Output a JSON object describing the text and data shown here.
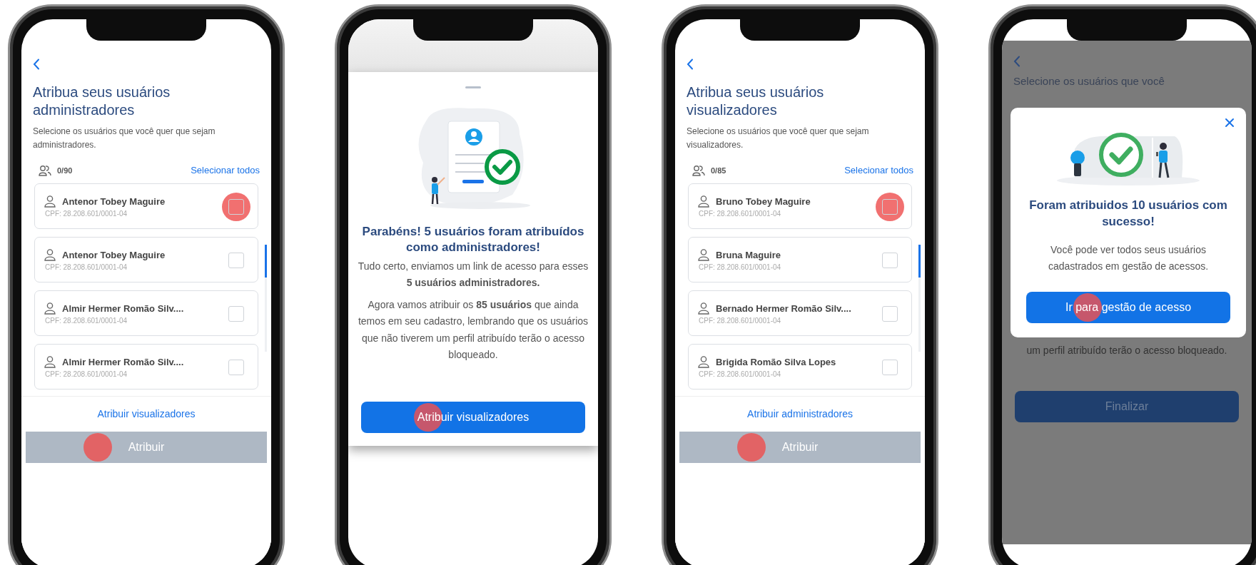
{
  "phones": [
    {
      "kind": "list",
      "title": "Atribua seus usuários administradores",
      "subtitle": "Selecione os usuários que você quer que sejam administradores.",
      "count": "0/90",
      "select_all": "Selecionar todos",
      "users": [
        {
          "name": "Antenor Tobey Maguire",
          "cpf": "CPF: 28.208.601/0001-04",
          "checked": false,
          "tapped": true
        },
        {
          "name": "Antenor Tobey Maguire",
          "cpf": "CPF: 28.208.601/0001-04",
          "checked": false,
          "tapped": false
        },
        {
          "name": "Almir Hermer Romão Silv....",
          "cpf": "CPF: 28.208.601/0001-04",
          "checked": false,
          "tapped": false
        },
        {
          "name": "Almir Hermer Romão Silv....",
          "cpf": "CPF: 28.208.601/0001-04",
          "checked": false,
          "tapped": false
        }
      ],
      "link": "Atribuir visualizadores",
      "button": {
        "label": "Atribuir",
        "disabled": true,
        "tapped": true
      }
    },
    {
      "kind": "sheet",
      "title": "Parabéns! 5 usuários foram atribuídos como administradores!",
      "paragraphs": [
        "Tudo certo, enviamos um link de acesso para esses **5 usuários administradores.**",
        "Agora vamos atribuir os **85 usuários** que ainda temos em seu cadastro, lembrando que os usuários que não tiverem um perfil atribuído terão o acesso bloqueado."
      ],
      "button": {
        "label": "Atribuir visualizadores",
        "disabled": false,
        "tapped": true
      }
    },
    {
      "kind": "list",
      "title": "Atribua seus usuários visualizadores",
      "subtitle": "Selecione os usuários que você quer que sejam visualizadores.",
      "count": "0/85",
      "select_all": "Selecionar todos",
      "users": [
        {
          "name": "Bruno Tobey Maguire",
          "cpf": "CPF: 28.208.601/0001-04",
          "checked": false,
          "tapped": true
        },
        {
          "name": "Bruna Maguire",
          "cpf": "CPF: 28.208.601/0001-04",
          "checked": false,
          "tapped": false
        },
        {
          "name": "Bernado Hermer Romão Silv....",
          "cpf": "CPF: 28.208.601/0001-04",
          "checked": false,
          "tapped": false
        },
        {
          "name": "Brigida Romão Silva Lopes",
          "cpf": "CPF: 28.208.601/0001-04",
          "checked": false,
          "tapped": false
        }
      ],
      "link": "Atribuir administradores",
      "button": {
        "label": "Atribuir",
        "disabled": true,
        "tapped": true
      }
    },
    {
      "kind": "modal",
      "background": {
        "intro": "Selecione os usuários que você",
        "text": "um perfil atribuído terão o acesso bloqueado.",
        "button": {
          "label": "Finalizar",
          "disabled": false,
          "tapped": false
        }
      },
      "title": "Foram atribuidos 10 usuários com sucesso!",
      "text": "Você pode ver todos seus usuários cadastrados em gestão de acessos.",
      "button": {
        "label": "Ir para gestão de acesso",
        "disabled": false,
        "tapped": true
      }
    }
  ]
}
